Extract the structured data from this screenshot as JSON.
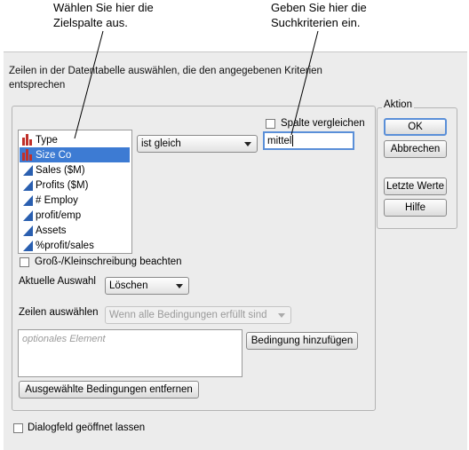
{
  "callouts": {
    "left": "Wählen Sie hier die\nZielspalte aus.",
    "right": "Geben Sie hier die\nSuchkriterien ein."
  },
  "dialog": {
    "description": "Zeilen in der Datentabelle auswählen, die den angegebenen Kriterien entsprechen",
    "columns": [
      {
        "label": "Type",
        "icon": "nominal-bar-icon",
        "selected": false
      },
      {
        "label": "Size Co",
        "icon": "nominal-bar-icon",
        "selected": true
      },
      {
        "label": "Sales ($M)",
        "icon": "continuous-triangle-icon",
        "selected": false
      },
      {
        "label": "Profits ($M)",
        "icon": "continuous-triangle-icon",
        "selected": false
      },
      {
        "label": "# Employ",
        "icon": "continuous-triangle-icon",
        "selected": false
      },
      {
        "label": "profit/emp",
        "icon": "continuous-triangle-icon",
        "selected": false
      },
      {
        "label": "Assets",
        "icon": "continuous-triangle-icon",
        "selected": false
      },
      {
        "label": "%profit/sales",
        "icon": "continuous-triangle-icon",
        "selected": false
      }
    ],
    "operator": "ist gleich",
    "compare_column_label": "Spalte vergleichen",
    "search_value": "mittel",
    "case_sensitive_label": "Groß-/Kleinschreibung beachten",
    "current_selection_label": "Aktuelle Auswahl",
    "current_selection_value": "Löschen",
    "select_rows_label": "Zeilen auswählen",
    "select_rows_value": "Wenn alle Bedingungen erfüllt sind",
    "optional_placeholder": "optionales Element",
    "add_condition": "Bedingung hinzufügen",
    "remove_conditions": "Ausgewählte Bedingungen entfernen",
    "keep_open_label": "Dialogfeld geöffnet lassen",
    "action": {
      "title": "Aktion",
      "ok": "OK",
      "cancel": "Abbrechen",
      "recall": "Letzte Werte",
      "help": "Hilfe"
    }
  },
  "colors": {
    "selection": "#3d7bd3",
    "nominal_icon": "#c0302a",
    "continuous_icon": "#2a5fb0",
    "focus": "#5a8fd8"
  }
}
